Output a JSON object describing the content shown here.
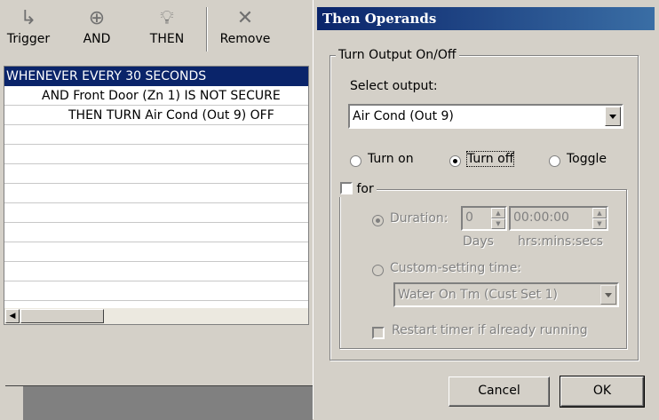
{
  "toolbar": {
    "trigger": "Trigger",
    "and": "AND",
    "then": "THEN",
    "remove": "Remove"
  },
  "rules": [
    "WHENEVER EVERY 30 SECONDS",
    "AND Front Door (Zn 1) IS NOT SECURE",
    "THEN TURN Air Cond (Out 9) OFF"
  ],
  "dialog": {
    "title": "Then Operands",
    "group_title": "Turn Output On/Off",
    "select_output_label": "Select output:",
    "selected_output": "Air Cond (Out 9)",
    "radio_turn_on": "Turn on",
    "radio_turn_off": "Turn off",
    "radio_toggle": "Toggle",
    "for_label": "for",
    "duration_label": "Duration:",
    "days_value": "0",
    "time_value": "00:00:00",
    "days_caption": "Days",
    "time_caption": "hrs:mins:secs",
    "custom_setting_label": "Custom-setting time:",
    "custom_setting_value": "Water On Tm (Cust Set 1)",
    "restart_label": "Restart timer if already running",
    "cancel": "Cancel",
    "ok": "OK"
  }
}
